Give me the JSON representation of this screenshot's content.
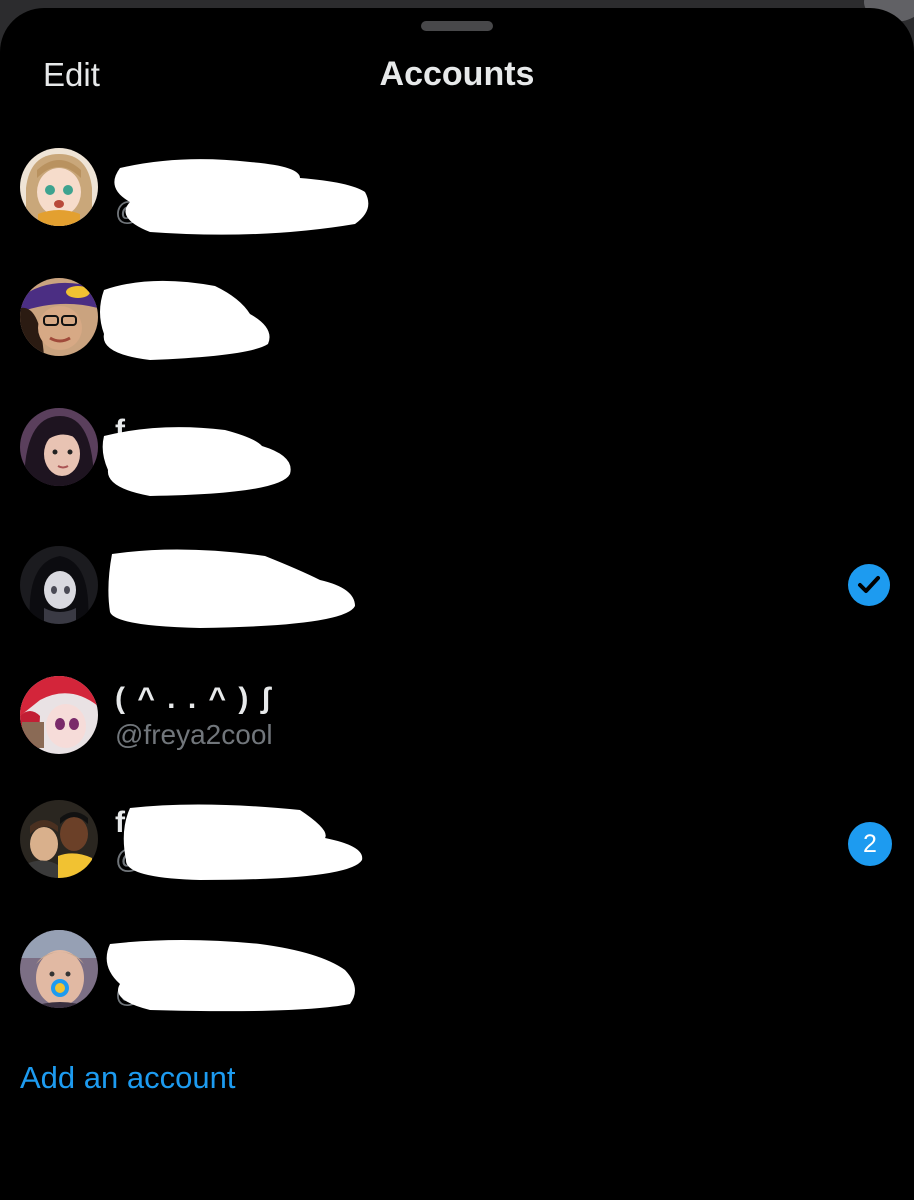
{
  "header": {
    "edit_label": "Edit",
    "title": "Accounts"
  },
  "accounts": [
    {
      "name": "",
      "handle": "@",
      "selected": false,
      "notifications": null,
      "avatar_desc": "anime-girl-blonde"
    },
    {
      "name": "",
      "handle": "",
      "selected": false,
      "notifications": null,
      "avatar_desc": "person-purple-cap"
    },
    {
      "name": "f",
      "handle": "",
      "selected": false,
      "notifications": null,
      "avatar_desc": "person-dark-hair"
    },
    {
      "name": "",
      "handle": "",
      "selected": true,
      "notifications": null,
      "avatar_desc": "anime-dark-hair"
    },
    {
      "name": "( ^ . . ^ ) ʃ",
      "handle": "@freya2cool",
      "selected": false,
      "notifications": null,
      "avatar_desc": "anime-red-hair"
    },
    {
      "name": "f",
      "handle": "@",
      "selected": false,
      "notifications": "2",
      "avatar_desc": "two-men-photo"
    },
    {
      "name": "",
      "handle": "@",
      "selected": false,
      "notifications": null,
      "avatar_desc": "man-with-pacifier"
    }
  ],
  "footer": {
    "add_account_label": "Add an account"
  },
  "colors": {
    "accent": "#1d9bf0",
    "background": "#000000",
    "primary_text": "#e7e9ea",
    "secondary_text": "#71767b"
  }
}
